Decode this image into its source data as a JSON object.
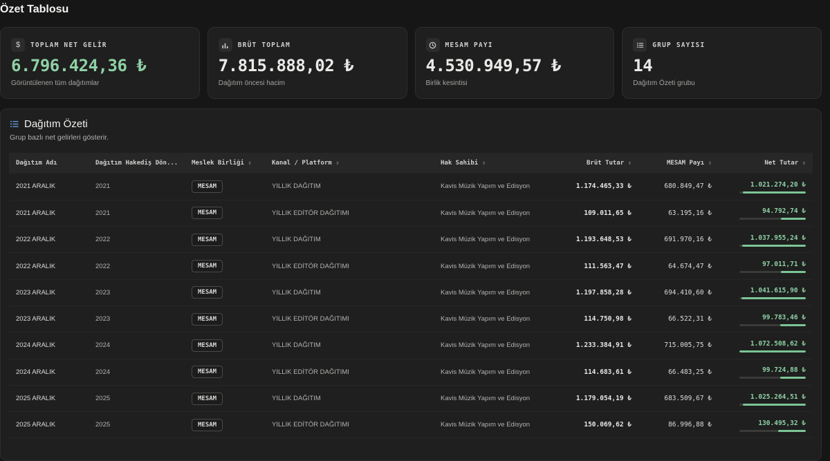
{
  "page": {
    "title": "Özet Tablosu"
  },
  "cards": [
    {
      "key": "net",
      "label": "TOPLAM NET GELİR",
      "value": "6.796.424,36 ₺",
      "sub": "Görüntülenen tüm dağıtımlar",
      "icon": "dollar-icon"
    },
    {
      "key": "brut",
      "label": "BRÜT TOPLAM",
      "value": "7.815.888,02 ₺",
      "sub": "Dağıtım öncesi hacim",
      "icon": "bar-chart-icon"
    },
    {
      "key": "mesam",
      "label": "MESAM PAYI",
      "value": "4.530.949,57 ₺",
      "sub": "Birlik kesintisi",
      "icon": "clock-icon"
    },
    {
      "key": "grup",
      "label": "GRUP SAYISI",
      "value": "14",
      "sub": "Dağıtım Özeti grubu",
      "icon": "list-icon"
    }
  ],
  "summary": {
    "title": "Dağıtım Özeti",
    "subtitle": "Grup bazlı net gelirleri gösterir.",
    "columns": [
      "Dağıtım Adı",
      "Dağıtım Hakediş Dön...",
      "Meslek Birliği",
      "Kanal / Platform",
      "Hak Sahibi",
      "Brüt Tutar",
      "MESAM Payı",
      "Net Tutar"
    ],
    "rows": [
      {
        "name": "2021 ARALIK",
        "period": "2021",
        "union": "MESAM",
        "channel": "YILLIK DAĞITIM",
        "owner": "Kavis Müzik Yapım ve Edisyon",
        "gross": "1.174.465,33 ₺",
        "mesam": "680.849,47 ₺",
        "net": "1.021.274,20 ₺",
        "net_ratio": 0.95
      },
      {
        "name": "2021 ARALIK",
        "period": "2021",
        "union": "MESAM",
        "channel": "YILLIK EDİTÖR DAĞITIMI",
        "owner": "Kavis Müzik Yapım ve Edisyon",
        "gross": "109.011,65 ₺",
        "mesam": "63.195,16 ₺",
        "net": "94.792,74 ₺",
        "net_ratio": 0.37
      },
      {
        "name": "2022 ARALIK",
        "period": "2022",
        "union": "MESAM",
        "channel": "YILLIK DAĞITIM",
        "owner": "Kavis Müzik Yapım ve Edisyon",
        "gross": "1.193.648,53 ₺",
        "mesam": "691.970,16 ₺",
        "net": "1.037.955,24 ₺",
        "net_ratio": 0.96
      },
      {
        "name": "2022 ARALIK",
        "period": "2022",
        "union": "MESAM",
        "channel": "YILLIK EDİTÖR DAĞITIMI",
        "owner": "Kavis Müzik Yapım ve Edisyon",
        "gross": "111.563,47 ₺",
        "mesam": "64.674,47 ₺",
        "net": "97.011,71 ₺",
        "net_ratio": 0.38
      },
      {
        "name": "2023 ARALIK",
        "period": "2023",
        "union": "MESAM",
        "channel": "YILLIK DAĞITIM",
        "owner": "Kavis Müzik Yapım ve Edisyon",
        "gross": "1.197.858,28 ₺",
        "mesam": "694.410,60 ₺",
        "net": "1.041.615,90 ₺",
        "net_ratio": 0.97
      },
      {
        "name": "2023 ARALIK",
        "period": "2023",
        "union": "MESAM",
        "channel": "YILLIK EDİTÖR DAĞITIMI",
        "owner": "Kavis Müzik Yapım ve Edisyon",
        "gross": "114.750,98 ₺",
        "mesam": "66.522,31 ₺",
        "net": "99.783,46 ₺",
        "net_ratio": 0.39
      },
      {
        "name": "2024 ARALIK",
        "period": "2024",
        "union": "MESAM",
        "channel": "YILLIK DAĞITIM",
        "owner": "Kavis Müzik Yapım ve Edisyon",
        "gross": "1.233.384,91 ₺",
        "mesam": "715.005,75 ₺",
        "net": "1.072.508,62 ₺",
        "net_ratio": 1.0
      },
      {
        "name": "2024 ARALIK",
        "period": "2024",
        "union": "MESAM",
        "channel": "YILLIK EDİTÖR DAĞITIMI",
        "owner": "Kavis Müzik Yapım ve Edisyon",
        "gross": "114.683,61 ₺",
        "mesam": "66.483,25 ₺",
        "net": "99.724,88 ₺",
        "net_ratio": 0.39
      },
      {
        "name": "2025 ARALIK",
        "period": "2025",
        "union": "MESAM",
        "channel": "YILLIK DAĞITIM",
        "owner": "Kavis Müzik Yapım ve Edisyon",
        "gross": "1.179.054,19 ₺",
        "mesam": "683.509,67 ₺",
        "net": "1.025.264,51 ₺",
        "net_ratio": 0.95
      },
      {
        "name": "2025 ARALIK",
        "period": "2025",
        "union": "MESAM",
        "channel": "YILLIK EDİTÖR DAĞITIMI",
        "owner": "Kavis Müzik Yapım ve Edisyon",
        "gross": "150.069,62 ₺",
        "mesam": "86.996,88 ₺",
        "net": "130.495,32 ₺",
        "net_ratio": 0.42
      }
    ]
  },
  "colors": {
    "accent_green": "#8fd0a6",
    "bar_fill": "#7cc596",
    "background": "#151615",
    "card": "#1e1f1e"
  }
}
